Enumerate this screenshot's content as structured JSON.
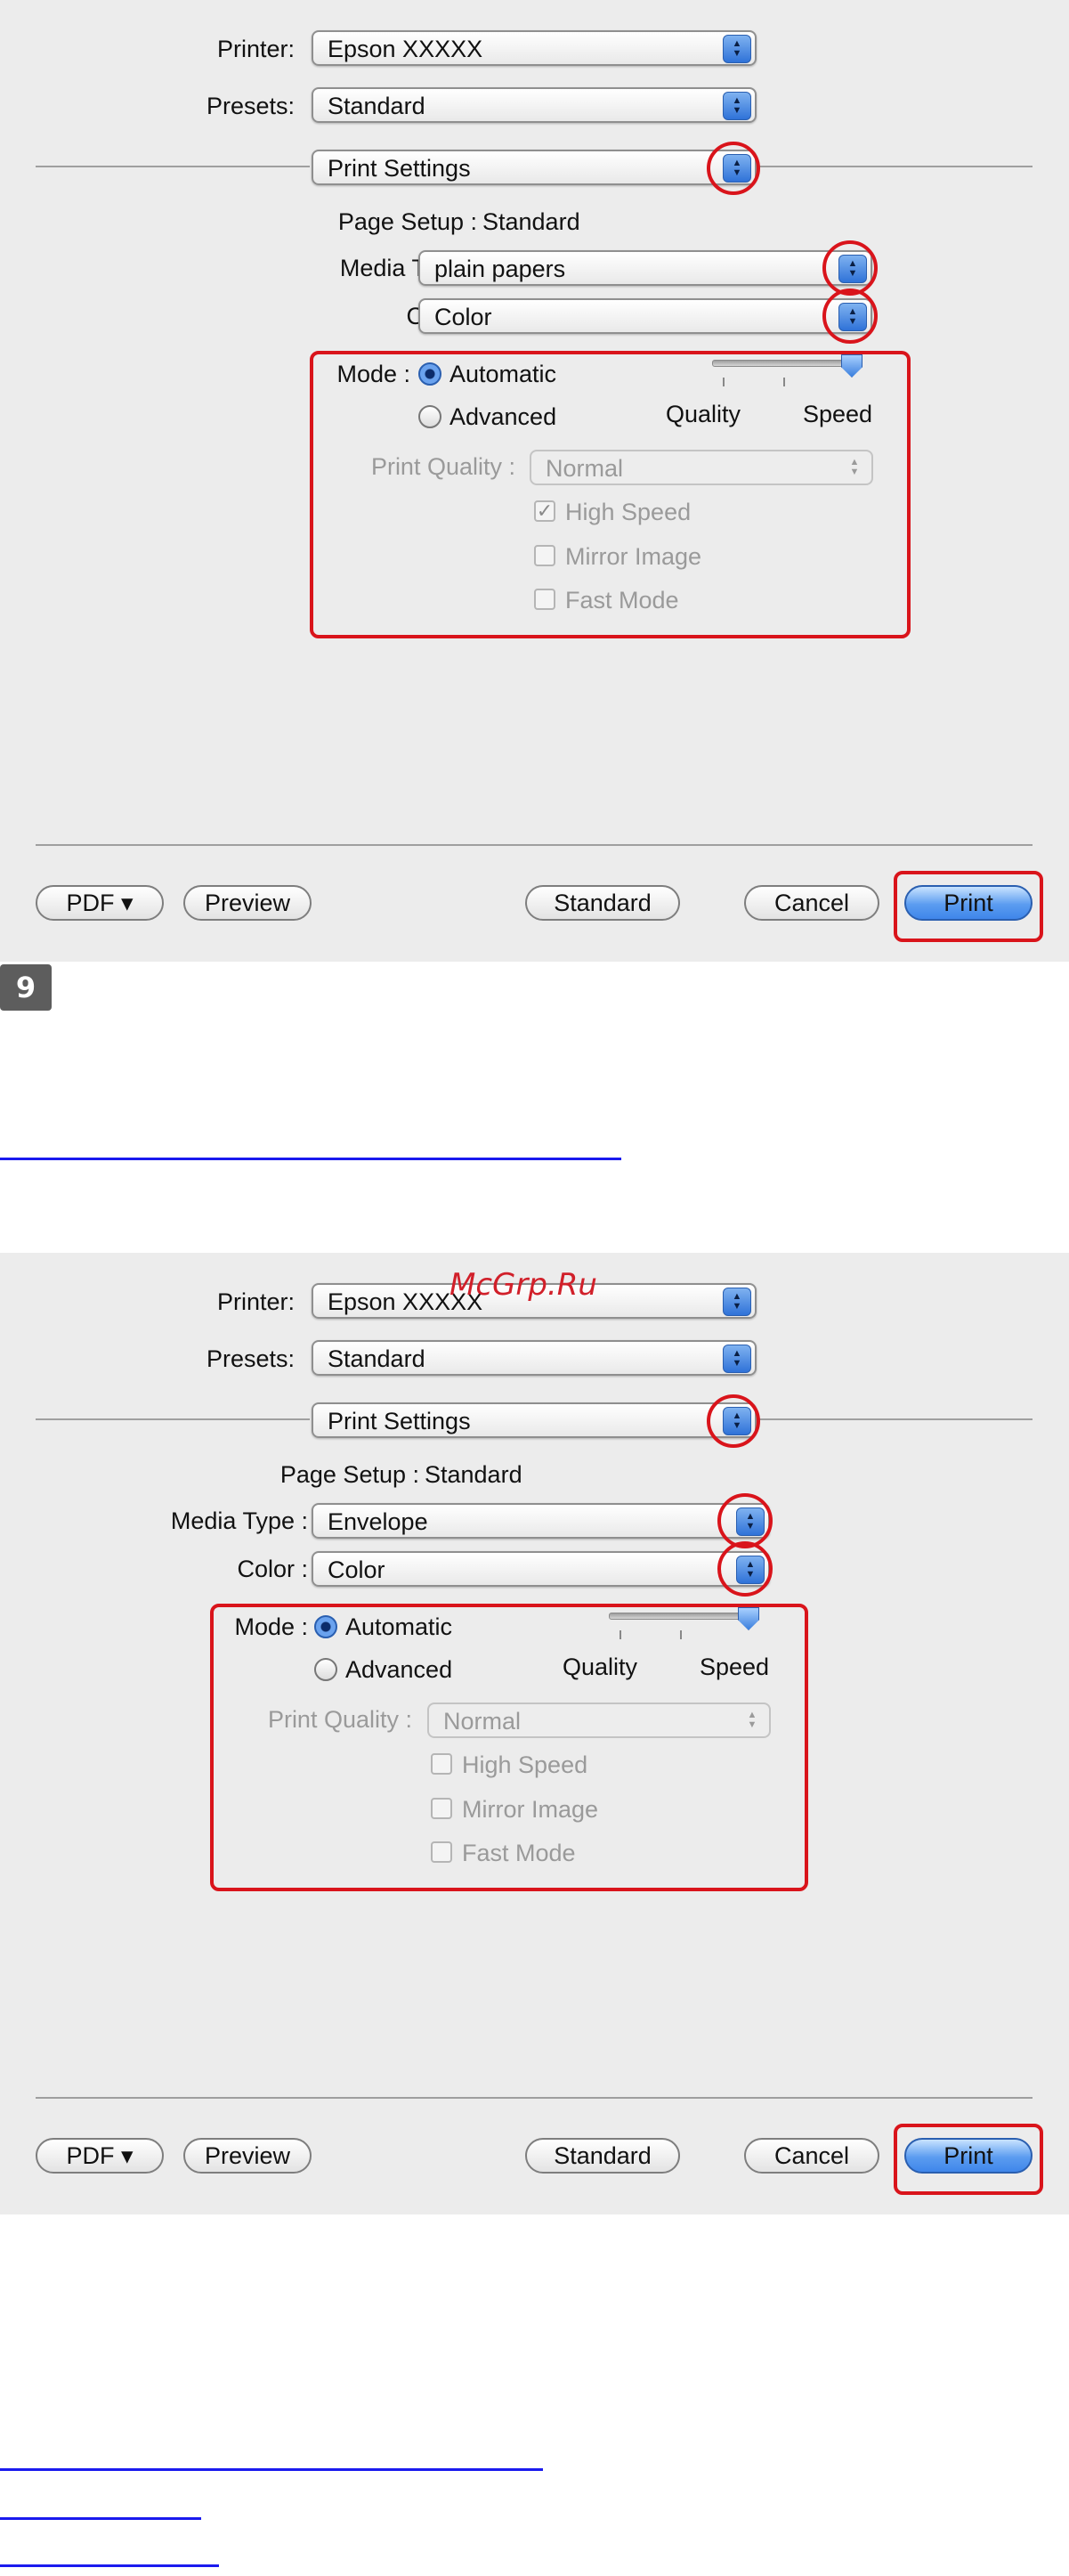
{
  "dialogs": [
    {
      "printer_label": "Printer:",
      "printer_value": "Epson  XXXXX",
      "presets_label": "Presets:",
      "presets_value": "Standard",
      "panel_value": "Print Settings",
      "page_setup_label": "Page Setup :",
      "page_setup_value": "Standard",
      "media_type_label": "Media Type :",
      "media_type_value": "plain papers",
      "color_label": "Color :",
      "color_value": "Color",
      "mode_label": "Mode :",
      "mode_automatic": "Automatic",
      "mode_advanced": "Advanced",
      "slider_quality": "Quality",
      "slider_speed": "Speed",
      "print_quality_label": "Print Quality :",
      "print_quality_value": "Normal",
      "high_speed": "High Speed",
      "high_speed_checked": true,
      "mirror_image": "Mirror Image",
      "fast_mode": "Fast Mode",
      "speed_level": 1.0,
      "buttons": {
        "pdf": "PDF ▾",
        "preview": "Preview",
        "standard": "Standard",
        "cancel": "Cancel",
        "print": "Print"
      }
    },
    {
      "printer_label": "Printer:",
      "printer_value": "Epson  XXXXX",
      "presets_label": "Presets:",
      "presets_value": "Standard",
      "panel_value": "Print Settings",
      "page_setup_label": "Page Setup :",
      "page_setup_value": "Standard",
      "media_type_label": "Media Type :",
      "media_type_value": "Envelope",
      "color_label": "Color :",
      "color_value": "Color",
      "mode_label": "Mode :",
      "mode_automatic": "Automatic",
      "mode_advanced": "Advanced",
      "slider_quality": "Quality",
      "slider_speed": "Speed",
      "print_quality_label": "Print Quality :",
      "print_quality_value": "Normal",
      "high_speed": "High Speed",
      "high_speed_checked": false,
      "mirror_image": "Mirror Image",
      "fast_mode": "Fast Mode",
      "speed_level": 1.0,
      "buttons": {
        "pdf": "PDF ▾",
        "preview": "Preview",
        "standard": "Standard",
        "cancel": "Cancel",
        "print": "Print"
      }
    }
  ],
  "step_number": "9",
  "watermark": "McGrp.Ru",
  "colors": {
    "highlight": "#d9141b",
    "link": "#1a1aee",
    "dialog_bg": "#ececec"
  }
}
